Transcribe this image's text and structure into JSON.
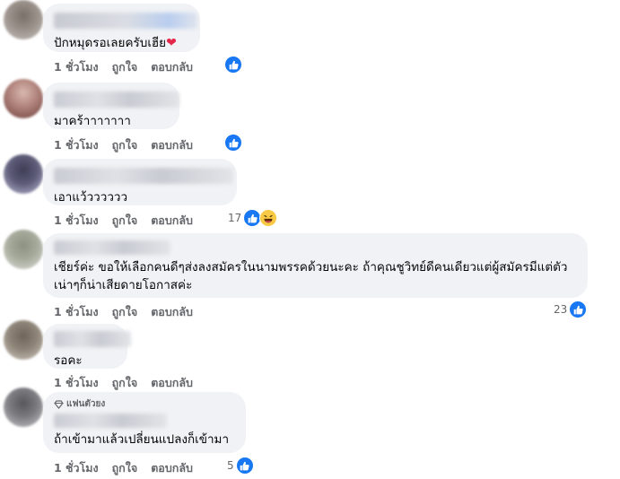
{
  "actions": {
    "time": "1 ชั่วโมง",
    "like": "ถูกใจ",
    "reply": "ตอบกลับ"
  },
  "comments": [
    {
      "text": "ปักหมุดรอเลยครับเฮีย",
      "heart": "❤"
    },
    {
      "text": "มาคร้าาาาาาา"
    },
    {
      "text": "เอาแว้วววววว",
      "reaction_count": "17"
    },
    {
      "text": "เชียร์ค่ะ ขอให้เลือกคนดีๆส่งลงสมัครในนามพรรคด้วยนะคะ ถ้าคุณชูวิทย์ดีคนเดียวแต่ผู้สมัครมีแต่ตัวเน่าๆก็น่าเสียดายโอกาสค่ะ",
      "reaction_count": "23"
    },
    {
      "text": "รอคะ"
    },
    {
      "badge": "แฟนตัวยง",
      "text": "ถ้าเข้ามาแล้วเปลี่ยนแปลงก็เข้ามา",
      "reaction_count": "5"
    }
  ],
  "icons": {
    "like": "thumbs-up-icon",
    "haha": "haha-emoji-icon",
    "badge": "diamond-icon"
  },
  "colors": {
    "bubble": "#f0f2f5",
    "like_blue": "#1877f2",
    "meta_gray": "#65676b"
  }
}
